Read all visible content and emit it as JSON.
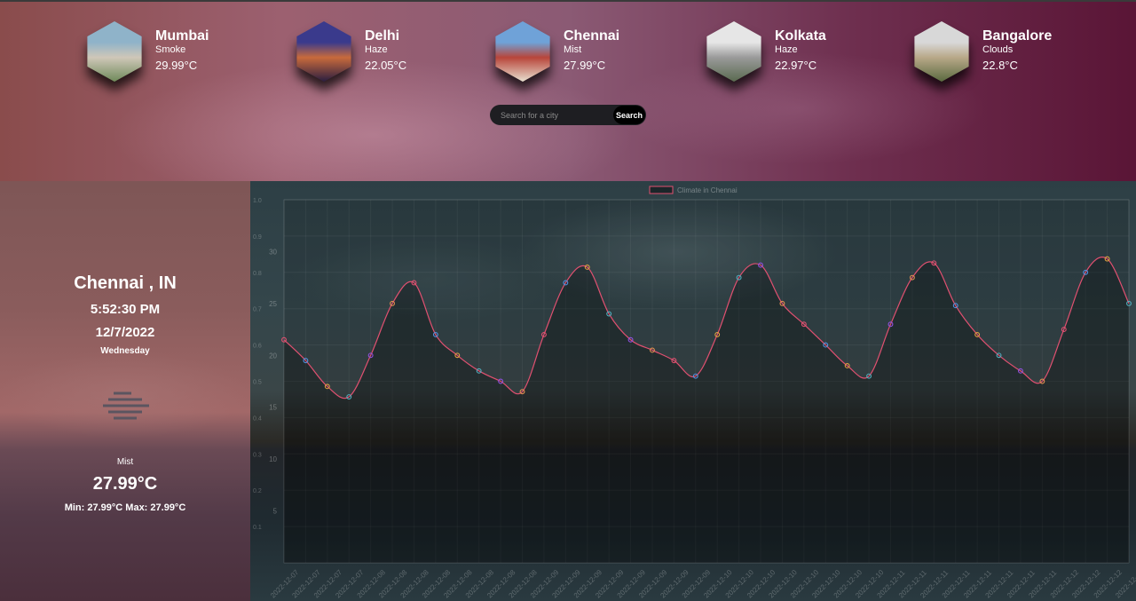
{
  "cities": [
    {
      "name": "Mumbai",
      "condition": "Smoke",
      "temp": "29.99°C",
      "colors": [
        "#8fb3c9",
        "#cfc7b8",
        "#6f8a5a"
      ]
    },
    {
      "name": "Delhi",
      "condition": "Haze",
      "temp": "22.05°C",
      "colors": [
        "#3a3a8c",
        "#c86a3c",
        "#2a1e40"
      ]
    },
    {
      "name": "Chennai",
      "condition": "Mist",
      "temp": "27.99°C",
      "colors": [
        "#6fa2d8",
        "#b8453a",
        "#e8e0d0"
      ]
    },
    {
      "name": "Kolkata",
      "condition": "Haze",
      "temp": "22.97°C",
      "colors": [
        "#e6e6e6",
        "#9a9a9a",
        "#5a6a50"
      ]
    },
    {
      "name": "Bangalore",
      "condition": "Clouds",
      "temp": "22.8°C",
      "colors": [
        "#d8d8d8",
        "#b8a888",
        "#5a6a40"
      ]
    }
  ],
  "search": {
    "placeholder": "Search for a city",
    "button_label": "Search"
  },
  "current": {
    "location": "Chennai , IN",
    "time": "5:52:30 PM",
    "date": "12/7/2022",
    "day": "Wednesday",
    "icon": "mist-icon",
    "condition": "Mist",
    "temp": "27.99°C",
    "minmax": "Min: 27.99°C Max: 27.99°C"
  },
  "chart_data": {
    "type": "line",
    "legend": "Climate in Chennai",
    "legend_position": "top-center",
    "grid": true,
    "line_color": "#e05070",
    "y_ticks": [
      "30",
      "25",
      "20",
      "15",
      "10",
      "5"
    ],
    "y2_ticks": [
      "1.0",
      "0.9",
      "0.8",
      "0.7",
      "0.6",
      "0.5",
      "0.4",
      "0.3",
      "0.2",
      "0.1"
    ],
    "ylim": [
      0,
      35
    ],
    "x": [
      "2022-12-07",
      "2022-12-07",
      "2022-12-07",
      "2022-12-07",
      "2022-12-08",
      "2022-12-08",
      "2022-12-08",
      "2022-12-08",
      "2022-12-08",
      "2022-12-08",
      "2022-12-08",
      "2022-12-08",
      "2022-12-09",
      "2022-12-09",
      "2022-12-09",
      "2022-12-09",
      "2022-12-09",
      "2022-12-09",
      "2022-12-09",
      "2022-12-09",
      "2022-12-10",
      "2022-12-10",
      "2022-12-10",
      "2022-12-10",
      "2022-12-10",
      "2022-12-10",
      "2022-12-10",
      "2022-12-10",
      "2022-12-11",
      "2022-12-11",
      "2022-12-11",
      "2022-12-11",
      "2022-12-11",
      "2022-12-11",
      "2022-12-11",
      "2022-12-11",
      "2022-12-12",
      "2022-12-12",
      "2022-12-12",
      "2022-12-12"
    ],
    "values": [
      21.5,
      19.5,
      17.0,
      16.0,
      20.0,
      25.0,
      27.0,
      22.0,
      20.0,
      18.5,
      17.5,
      16.5,
      22.0,
      27.0,
      28.5,
      24.0,
      21.5,
      20.5,
      19.5,
      18.0,
      22.0,
      27.5,
      28.7,
      25.0,
      23.0,
      21.0,
      19.0,
      18.0,
      23.0,
      27.5,
      28.9,
      24.8,
      22.0,
      20.0,
      18.5,
      17.5,
      22.5,
      28.0,
      29.3,
      25.0
    ],
    "point_colors": [
      "#e05070",
      "#5090e0",
      "#e0a040",
      "#50b0c0",
      "#9050e0",
      "#e09050",
      "#e05070",
      "#5090e0",
      "#e0a040",
      "#50b0c0",
      "#9050e0",
      "#e09050"
    ]
  }
}
